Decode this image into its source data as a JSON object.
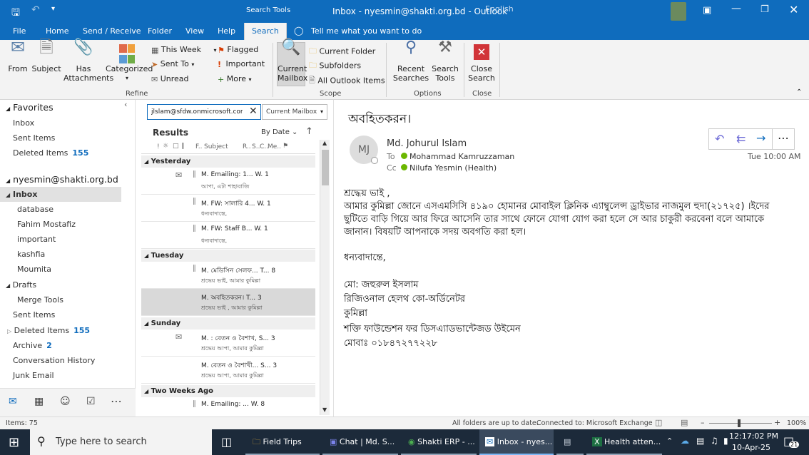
{
  "titlebar": {
    "context_tab": "Search Tools",
    "window_title": "Inbox - nyesmin@shakti.org.bd - Outlook",
    "language": "English"
  },
  "tabs": [
    "File",
    "Home",
    "Send / Receive",
    "Folder",
    "View",
    "Help",
    "Search"
  ],
  "tell_me": "Tell me what you want to do",
  "ribbon": {
    "from": "From",
    "subject": "Subject",
    "has_attachments": "Has Attachments",
    "categorized": "Categorized",
    "this_week": "This Week",
    "sent_to": "Sent To",
    "unread": "Unread",
    "flagged": "Flagged",
    "important": "Important",
    "more": "More",
    "refine": "Refine",
    "current_mailbox": "Current Mailbox",
    "current_folder": "Current Folder",
    "subfolders": "Subfolders",
    "all_outlook_items": "All Outlook Items",
    "scope": "Scope",
    "recent_searches": "Recent Searches",
    "search_tools": "Search Tools",
    "options": "Options",
    "close_search": "Close Search",
    "close": "Close"
  },
  "nav": {
    "favorites": "Favorites",
    "fav_items": [
      {
        "label": "Inbox",
        "count": ""
      },
      {
        "label": "Sent Items",
        "count": ""
      },
      {
        "label": "Deleted Items",
        "count": "155"
      }
    ],
    "account": "nyesmin@shakti.org.bd",
    "inbox": "Inbox",
    "inbox_children": [
      "database",
      "Fahim Mostafiz",
      "important",
      "kashfia",
      "Moumita"
    ],
    "drafts": "Drafts",
    "drafts_children": [
      "Merge Tools"
    ],
    "sent_items": "Sent Items",
    "deleted_items": "Deleted Items",
    "deleted_count": "155",
    "archive": "Archive",
    "archive_count": "2",
    "conversation_history": "Conversation History",
    "junk_email": "Junk Email"
  },
  "search": {
    "query": "jlslam@sfdw.onmicrosoft.com\"",
    "scope": "Current Mailbox"
  },
  "list": {
    "results": "Results",
    "sort": "By Date",
    "col_f": "F..",
    "col_subject": "Subject",
    "col_r": "R..",
    "col_s": "S..",
    "col_c": "C..",
    "col_me": "Me..",
    "groups": [
      {
        "label": "Yesterday",
        "messages": [
          {
            "subject": "M. Emailing: 1...",
            "sender": "W.",
            "size": "1",
            "preview": "আপা, এটা শাহাবাজি",
            "env": true
          },
          {
            "subject": "M. FW: সালারি 4...",
            "sender": "W.",
            "size": "1",
            "preview": "ধন্যবাদান্তে,",
            "env": false
          },
          {
            "subject": "M. FW: Staff B...",
            "sender": "W.",
            "size": "1",
            "preview": "ধন্যবাদান্তে,",
            "env": false
          }
        ]
      },
      {
        "label": "Tuesday",
        "messages": [
          {
            "subject": "M. মেডিসিন সেলফ...",
            "sender": "T...",
            "size": "8",
            "preview": "শ্রদ্ধেয় ভাই, আমার কুমিল্লা",
            "env": false
          },
          {
            "subject": "M. অবহিতকরন।",
            "sender": "T...",
            "size": "3",
            "preview": "শ্রদ্ধেয় ভাই , আমার কুমিল্লা",
            "env": false,
            "selected": true
          }
        ]
      },
      {
        "label": "Sunday",
        "messages": [
          {
            "subject": "M. : বেতন ও বৈশাখ,",
            "sender": "S...",
            "size": "3",
            "preview": "শ্রদ্ধেয় আপা, আমার কুমিল্লা",
            "env": true
          },
          {
            "subject": "M. বেতন ও বৈশাখী...",
            "sender": "S...",
            "size": "3",
            "preview": "শ্রদ্ধেয় আপা, আমার কুমিল্লা",
            "env": false
          }
        ]
      },
      {
        "label": "Two Weeks Ago",
        "messages": [
          {
            "subject": "M. Emailing: ...",
            "sender": "W.",
            "size": "8",
            "preview": "",
            "env": false
          }
        ]
      }
    ]
  },
  "email": {
    "subject": "অবহিতকরন।",
    "initials": "MJ",
    "sender": "Md. Johurul Islam",
    "to_label": "To",
    "to": "Mohammad  Kamruzzaman",
    "cc_label": "Cc",
    "cc": "Nilufa Yesmin (Health)",
    "time": "Tue 10:00 AM",
    "body": [
      "শ্রদ্ধেয় ভাই ,",
      "আমার কুমিল্লা জোনে এসএমসিসি ৪১৯০ হোমানর মোবাইল ক্লিনিক এ্যাম্বুলেন্স ড্রাইভার নাজমুল হুদা(২১৭২৫) ।ইদের",
      "ছুটিতে বাড়ি গিয়ে আর ফিরে আসেনি তার সাথে ফোনে যোগা যোগ করা হলে সে আর চাকুরী করবেনা বলে আমাকে",
      "জানান। বিষয়টি আপনাকে সদয় অবগতি করা হল।",
      "",
      "ধন্যবাদান্তে,",
      "",
      "মো:  জহুরুল  ইসলাম",
      "রিজিওনাল  হেলথ  কো-অর্ডিনেটর",
      "কুমিল্লা",
      "শক্তি  ফাউন্ডেশন  ফর  ডিসএ্যাডভান্টেজড  উইমেন",
      "মোবাঃ  ০১৮৪৭২৭৭২২৮"
    ]
  },
  "status": {
    "items": "Items: 75",
    "sync": "All folders are up to date.",
    "connection": "Connected to: Microsoft Exchange",
    "zoom": "100%"
  },
  "taskbar": {
    "search_placeholder": "Type here to search",
    "apps": [
      {
        "label": "Field Trips",
        "icon": "folder"
      },
      {
        "label": "Chat | Md. S...",
        "icon": "teams"
      },
      {
        "label": "Shakti ERP - ...",
        "icon": "chrome"
      },
      {
        "label": "Inbox - nyes...",
        "icon": "outlook"
      },
      {
        "label": "",
        "icon": "app"
      },
      {
        "label": "Health atten...",
        "icon": "excel"
      }
    ],
    "time": "12:17:02 PM",
    "date": "10-Apr-25",
    "notif_count": "21"
  },
  "colors": {
    "accent": "#0f6cbd",
    "taskbar": "#1c2a3a",
    "link_count": "#0f6cbd"
  }
}
